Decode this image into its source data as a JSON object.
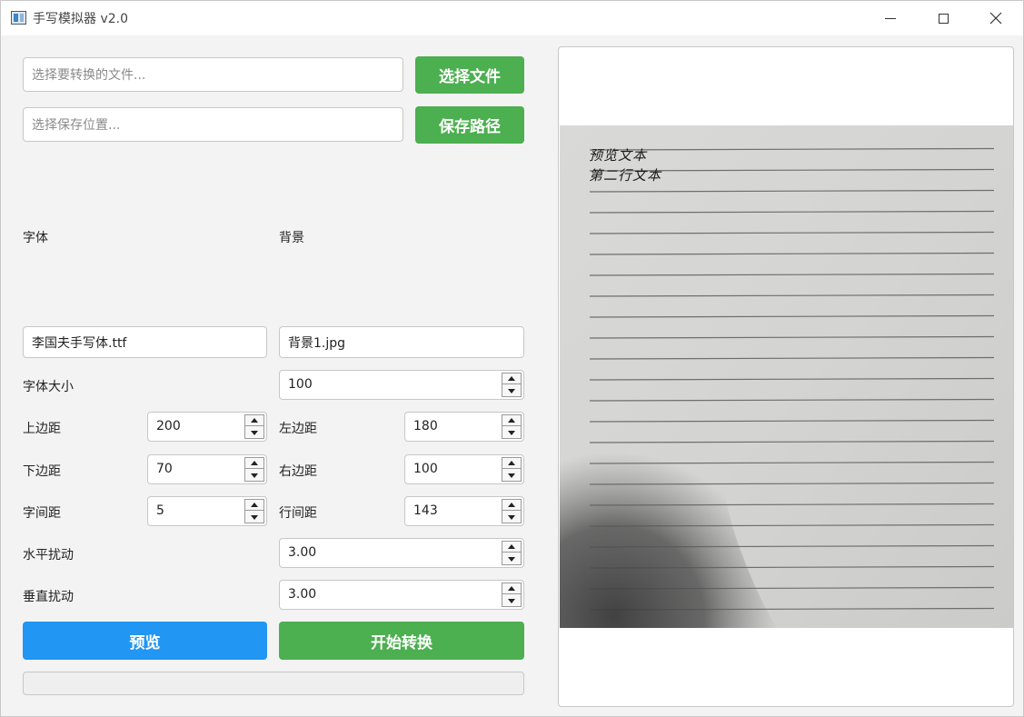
{
  "window": {
    "title": "手写模拟器 v2.0",
    "icon": "app-window-icon"
  },
  "file_row": {
    "input_placeholder": "选择要转换的文件...",
    "button_label": "选择文件"
  },
  "save_row": {
    "input_placeholder": "选择保存位置...",
    "button_label": "保存路径"
  },
  "font_section": {
    "label": "字体",
    "value": "李国夫手写体.ttf"
  },
  "background_section": {
    "label": "背景",
    "value": "背景1.jpg"
  },
  "params": {
    "font_size": {
      "label": "字体大小",
      "value": "100"
    },
    "top_margin": {
      "label": "上边距",
      "value": "200"
    },
    "left_margin": {
      "label": "左边距",
      "value": "180"
    },
    "bottom_margin": {
      "label": "下边距",
      "value": "70"
    },
    "right_margin": {
      "label": "右边距",
      "value": "100"
    },
    "char_spacing": {
      "label": "字间距",
      "value": "5"
    },
    "line_spacing": {
      "label": "行间距",
      "value": "143"
    },
    "h_perturb": {
      "label": "水平扰动",
      "value": "3.00"
    },
    "v_perturb": {
      "label": "垂直扰动",
      "value": "3.00"
    }
  },
  "actions": {
    "preview_label": "预览",
    "convert_label": "开始转换"
  },
  "progress": {
    "value": 0
  },
  "preview": {
    "lines": [
      "预览文本",
      "第二行文本"
    ],
    "ruled_line_count": 23
  },
  "colors": {
    "green": "#4caf50",
    "blue": "#2196f3"
  }
}
